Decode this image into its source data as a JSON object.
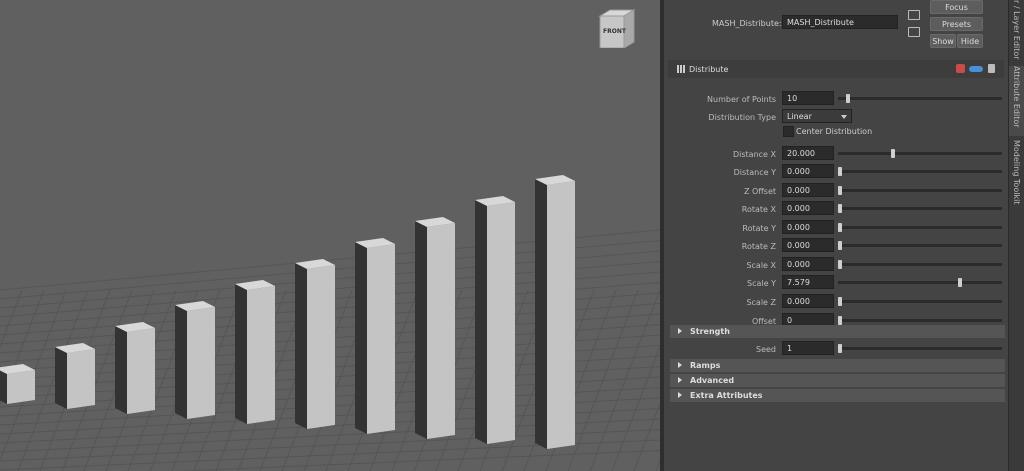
{
  "viewport": {
    "viewcube_label": "FRONT",
    "bars": [
      {
        "h": 30
      },
      {
        "h": 50
      },
      {
        "h": 70
      },
      {
        "h": 90
      },
      {
        "h": 110
      },
      {
        "h": 130
      },
      {
        "h": 150
      },
      {
        "h": 170
      },
      {
        "h": 190
      },
      {
        "h": 210
      }
    ]
  },
  "attribute_editor": {
    "node_label": "MASH_Distribute:",
    "node_name": "MASH_Distribute",
    "focus_label": "Focus",
    "presets_label": "Presets",
    "show_label": "Show",
    "hide_label": "Hide",
    "section_title": "Distribute",
    "center_distribution_label": "Center Distribution",
    "rows": [
      {
        "label": "Number of Points",
        "value": "10",
        "slider": 0.05
      },
      {
        "label": "Distribution Type",
        "value": "Linear",
        "dropdown": true
      },
      {
        "label": "Distance X",
        "value": "20.000",
        "slider": 0.33
      },
      {
        "label": "Distance Y",
        "value": "0.000",
        "slider": 0
      },
      {
        "label": "Z Offset",
        "value": "0.000",
        "slider": 0
      },
      {
        "label": "Rotate X",
        "value": "0.000",
        "slider": 0
      },
      {
        "label": "Rotate Y",
        "value": "0.000",
        "slider": 0
      },
      {
        "label": "Rotate Z",
        "value": "0.000",
        "slider": 0
      },
      {
        "label": "Scale X",
        "value": "0.000",
        "slider": 0
      },
      {
        "label": "Scale Y",
        "value": "7.579",
        "slider": 0.75
      },
      {
        "label": "Scale Z",
        "value": "0.000",
        "slider": 0
      },
      {
        "label": "Offset",
        "value": "0",
        "slider": 0
      }
    ],
    "strength_label": "Strength",
    "seed_label": "Seed",
    "seed_value": "1",
    "seed_slider": 0,
    "collapsed_sections": [
      "Ramps",
      "Advanced",
      "Extra Attributes"
    ]
  },
  "side_tabs": [
    "r / Layer Editor",
    "Attribute Editor",
    "Modeling Toolkit"
  ]
}
